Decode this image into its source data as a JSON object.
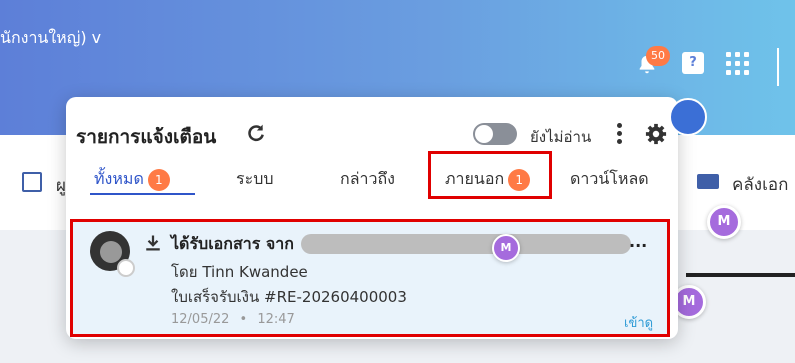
{
  "header": {
    "company_label": "นักงานใหญ่) v",
    "bell_badge": "50",
    "help_icon_char": "?"
  },
  "background": {
    "left_tab_label": "ผู",
    "library_label": "คลังเอก",
    "m_avatar_letter": "M"
  },
  "panel": {
    "title": "รายการแจ้งเตือน",
    "unread_toggle_label": "ยังไม่อ่าน",
    "tabs": [
      {
        "label": "ทั้งหมด",
        "badge": "1"
      },
      {
        "label": "ระบบ"
      },
      {
        "label": "กล่าวถึง"
      },
      {
        "label": "ภายนอก",
        "badge": "1"
      },
      {
        "label": "ดาวน์โหลด"
      }
    ],
    "notification": {
      "title": "ได้รับเอกสาร จาก",
      "ellipsis": "...",
      "by": "โดย Tinn Kwandee",
      "document": "ใบเสร็จรับเงิน #RE-20260400003",
      "date": "12/05/22",
      "separator": "•",
      "time": "12:47",
      "view_link": "เข้าดู"
    }
  },
  "colors": {
    "accent": "#2f55c9",
    "badge": "#ff7a45",
    "highlight_border": "#e00000",
    "notif_bg": "#e9f3fb"
  }
}
